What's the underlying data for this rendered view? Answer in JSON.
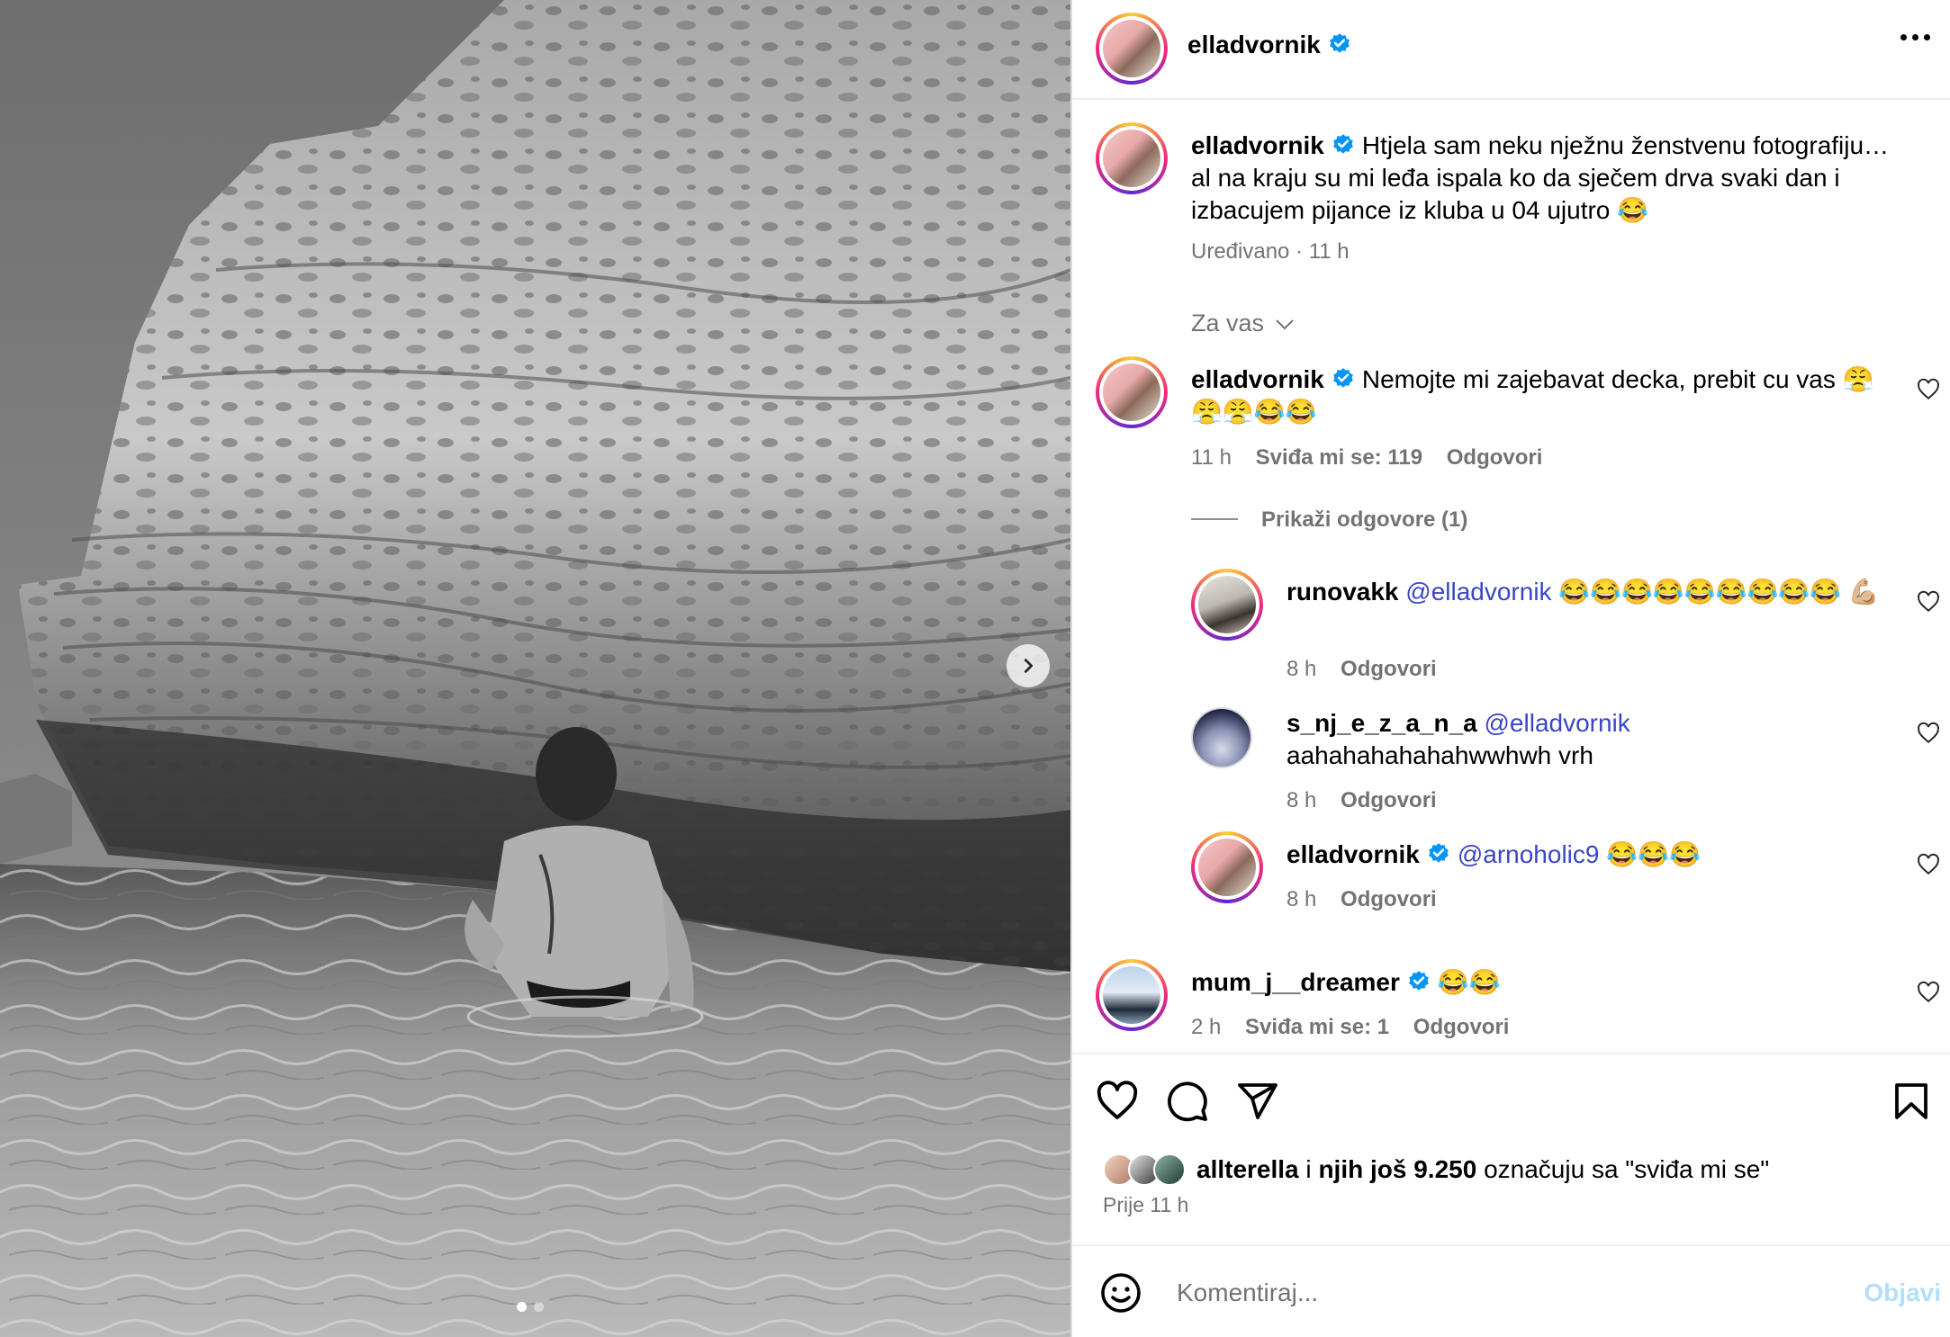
{
  "header": {
    "username": "elladvornik",
    "more_icon": "more-horizontal-icon"
  },
  "caption": {
    "username": "elladvornik",
    "text": "Htjela sam neku nježnu ženstvenu fotografiju… al na kraju su mi leđa ispala ko da sječem drva svaki dan i izbacujem pijance iz kluba u 04 ujutro 😂",
    "meta": "Uređivano · 11 h"
  },
  "sort": {
    "label": "Za vas"
  },
  "comments": [
    {
      "username": "elladvornik",
      "text": "Nemojte mi zajebavat decka, prebit cu vas 😤 😤😤😂😂",
      "time": "11 h",
      "likes": "Sviđa mi se: 119",
      "reply": "Odgovori",
      "view_replies": "Prikaži odgovore (1)"
    }
  ],
  "replies": [
    {
      "username": "runovakk",
      "mention": "@elladvornik",
      "text": "😂😂😂😂😂😂😂😂😂 💪🏼",
      "time": "8 h",
      "reply": "Odgovori"
    },
    {
      "username": "s_nj_e_z_a_n_a",
      "mention": "@elladvornik",
      "text": "aahahahahahahwwhwh vrh",
      "time": "8 h",
      "reply": "Odgovori"
    },
    {
      "username": "elladvornik",
      "mention": "@arnoholic9",
      "text": "😂😂😂",
      "time": "8 h",
      "reply": "Odgovori"
    }
  ],
  "comment2": {
    "username": "mum_j__dreamer",
    "text": "😂😂",
    "time": "2 h",
    "likes": "Sviđa mi se: 1",
    "reply": "Odgovori"
  },
  "likes": {
    "user": "allterella",
    "middle": "i",
    "count": "njih još 9.250",
    "suffix": "označuju sa \"sviđa mi se\"",
    "time": "Prije 11 h"
  },
  "comment_box": {
    "placeholder": "Komentiraj...",
    "post_label": "Objavi"
  },
  "photo": {
    "current_slide": 1,
    "total_slides": 2
  },
  "colors": {
    "verified": "#0095f6",
    "mention": "#3a45c7",
    "meta": "#737373",
    "post_disabled": "#b2dffc"
  }
}
